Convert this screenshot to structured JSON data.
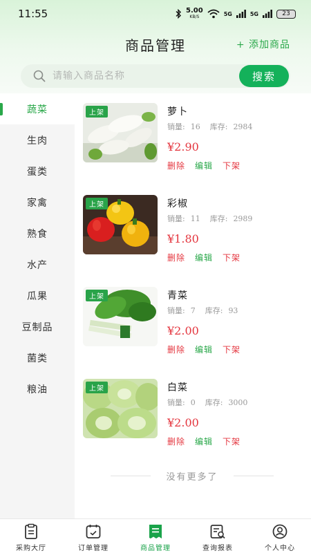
{
  "status_bar": {
    "time": "11:55",
    "speed_value": "5.00",
    "speed_unit": "KB/S",
    "signal1": "5G",
    "signal2": "5G",
    "battery": "23"
  },
  "header": {
    "title": "商品管理",
    "add_label": "+ 添加商品"
  },
  "search": {
    "placeholder": "请输入商品名称",
    "button_label": "搜索"
  },
  "categories": [
    {
      "label": "蔬菜",
      "active": true
    },
    {
      "label": "生肉"
    },
    {
      "label": "蛋类"
    },
    {
      "label": "家禽"
    },
    {
      "label": "熟食"
    },
    {
      "label": "水产"
    },
    {
      "label": "瓜果"
    },
    {
      "label": "豆制品"
    },
    {
      "label": "菌类"
    },
    {
      "label": "粮油"
    }
  ],
  "labels": {
    "sales": "销量:",
    "stock": "库存:",
    "badge": "上架",
    "delete": "删除",
    "edit": "编辑",
    "take_down": "下架"
  },
  "products": [
    {
      "name": "萝卜",
      "sales": "16",
      "stock": "2984",
      "price": "¥2.90",
      "image": "radish"
    },
    {
      "name": "彩椒",
      "sales": "11",
      "stock": "2989",
      "price": "¥1.80",
      "image": "bell-pepper"
    },
    {
      "name": "青菜",
      "sales": "7",
      "stock": "93",
      "price": "¥2.00",
      "image": "greens"
    },
    {
      "name": "白菜",
      "sales": "0",
      "stock": "3000",
      "price": "¥2.00",
      "image": "napa-cabbage"
    }
  ],
  "footer_note": "没有更多了",
  "bottom_nav": [
    {
      "label": "采购大厅",
      "icon": "clipboard-icon"
    },
    {
      "label": "订单管理",
      "icon": "calendar-icon"
    },
    {
      "label": "商品管理",
      "icon": "product-list-icon",
      "active": true
    },
    {
      "label": "查询报表",
      "icon": "report-search-icon"
    },
    {
      "label": "个人中心",
      "icon": "user-icon"
    }
  ],
  "colors": {
    "brand": "#14b15a",
    "accent_text": "#2aa84a",
    "price": "#e4363f"
  }
}
